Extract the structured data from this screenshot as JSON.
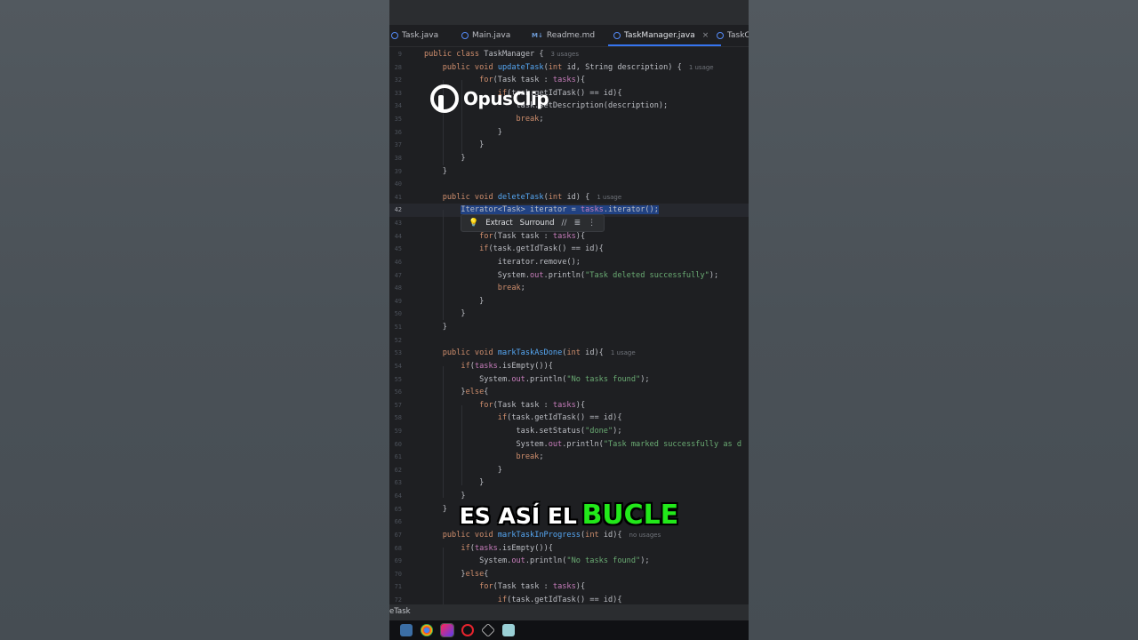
{
  "tabs": [
    {
      "label": "Task.java",
      "type": "java"
    },
    {
      "label": "Main.java",
      "type": "java"
    },
    {
      "label": "Readme.md",
      "type": "md",
      "prefix": "M↓"
    },
    {
      "label": "TaskManager.java",
      "type": "java",
      "active": true
    },
    {
      "label": "TaskC",
      "type": "java"
    }
  ],
  "close_symbol": "×",
  "code_lines": [
    {
      "n": "9",
      "html": "<span class='kw'>public class</span> TaskManager {<span class='hint'>3 usages</span>"
    },
    {
      "n": "28",
      "html": "    <span class='kw'>public void</span> <span class='fn'>updateTask</span>(<span class='kw'>int</span> id, String description) {<span class='hint'>1 usage</span>"
    },
    {
      "n": "32",
      "html": "            <span class='kw'>for</span>(Task task : <span class='fld'>tasks</span>){"
    },
    {
      "n": "33",
      "html": "                <span class='kw'>if</span>(task.getIdTask() == id){"
    },
    {
      "n": "34",
      "html": "                    task.setDescription(description);"
    },
    {
      "n": "35",
      "html": "                    <span class='kw'>break</span>;"
    },
    {
      "n": "36",
      "html": "                }"
    },
    {
      "n": "37",
      "html": "            }"
    },
    {
      "n": "38",
      "html": "        }"
    },
    {
      "n": "39",
      "html": "    }"
    },
    {
      "n": "40",
      "html": ""
    },
    {
      "n": "41",
      "html": "    <span class='kw'>public void</span> <span class='fn'>deleteTask</span>(<span class='kw'>int</span> id) {<span class='hint'>1 usage</span>"
    },
    {
      "n": "42",
      "html": "        <span class='sel'>Iterator&lt;Task&gt; iterator = <span class='fld'>tasks</span>.iterator();</span>",
      "current": true
    },
    {
      "n": "43",
      "html": ""
    },
    {
      "n": "44",
      "html": "            <span class='kw'>for</span>(Task task : <span class='fld'>tasks</span>){"
    },
    {
      "n": "45",
      "html": "            <span class='kw'>if</span>(task.getIdTask() == id){"
    },
    {
      "n": "46",
      "html": "                iterator.remove();"
    },
    {
      "n": "47",
      "html": "                System.<span class='fld'>out</span>.println(<span class='st'>\"Task deleted successfully\"</span>);"
    },
    {
      "n": "48",
      "html": "                <span class='kw'>break</span>;"
    },
    {
      "n": "49",
      "html": "            }"
    },
    {
      "n": "50",
      "html": "        }"
    },
    {
      "n": "51",
      "html": "    }"
    },
    {
      "n": "52",
      "html": ""
    },
    {
      "n": "53",
      "html": "    <span class='kw'>public void</span> <span class='fn'>markTaskAsDone</span>(<span class='kw'>int</span> id){<span class='hint'>1 usage</span>"
    },
    {
      "n": "54",
      "html": "        <span class='kw'>if</span>(<span class='fld'>tasks</span>.isEmpty()){"
    },
    {
      "n": "55",
      "html": "            System.<span class='fld'>out</span>.println(<span class='st'>\"No tasks found\"</span>);"
    },
    {
      "n": "56",
      "html": "        }<span class='kw'>else</span>{"
    },
    {
      "n": "57",
      "html": "            <span class='kw'>for</span>(Task task : <span class='fld'>tasks</span>){"
    },
    {
      "n": "58",
      "html": "                <span class='kw'>if</span>(task.getIdTask() == id){"
    },
    {
      "n": "59",
      "html": "                    task.setStatus(<span class='st'>\"done\"</span>);"
    },
    {
      "n": "60",
      "html": "                    System.<span class='fld'>out</span>.println(<span class='st'>\"Task marked successfully as d</span>"
    },
    {
      "n": "61",
      "html": "                    <span class='kw'>break</span>;"
    },
    {
      "n": "62",
      "html": "                }"
    },
    {
      "n": "63",
      "html": "            }"
    },
    {
      "n": "64",
      "html": "        }"
    },
    {
      "n": "65",
      "html": "    }"
    },
    {
      "n": "66",
      "html": ""
    },
    {
      "n": "67",
      "html": "    <span class='kw'>public void</span> <span class='fn'>markTaskInProgress</span>(<span class='kw'>int</span> id){<span class='hint'>no usages</span>"
    },
    {
      "n": "68",
      "html": "        <span class='kw'>if</span>(<span class='fld'>tasks</span>.isEmpty()){"
    },
    {
      "n": "69",
      "html": "            System.<span class='fld'>out</span>.println(<span class='st'>\"No tasks found\"</span>);"
    },
    {
      "n": "70",
      "html": "        }<span class='kw'>else</span>{"
    },
    {
      "n": "71",
      "html": "            <span class='kw'>for</span>(Task task : <span class='fld'>tasks</span>){"
    },
    {
      "n": "72",
      "html": "                <span class='kw'>if</span>(task.getIdTask() == id){"
    }
  ],
  "popup": {
    "extract": "Extract",
    "surround": "Surround",
    "comment_symbol": "//",
    "format_symbol": "≣",
    "more_symbol": "⋮"
  },
  "status": {
    "text": "eTask"
  },
  "taskbar_icons": [
    "explorer-icon",
    "chrome-icon",
    "intellij-icon",
    "opera-icon",
    "unity-icon",
    "notes-icon"
  ],
  "watermark": {
    "brand": "OpusClip"
  },
  "caption": {
    "words": [
      "ES ASÍ EL"
    ],
    "highlight": "BUCLE",
    "highlight_color": "#22e81a"
  },
  "colors": {
    "background": "#1e1f22",
    "keyword": "#cf8e6d",
    "function": "#56a8f5",
    "field": "#c77dbb",
    "string": "#6aab73",
    "accent": "#3574f0"
  }
}
